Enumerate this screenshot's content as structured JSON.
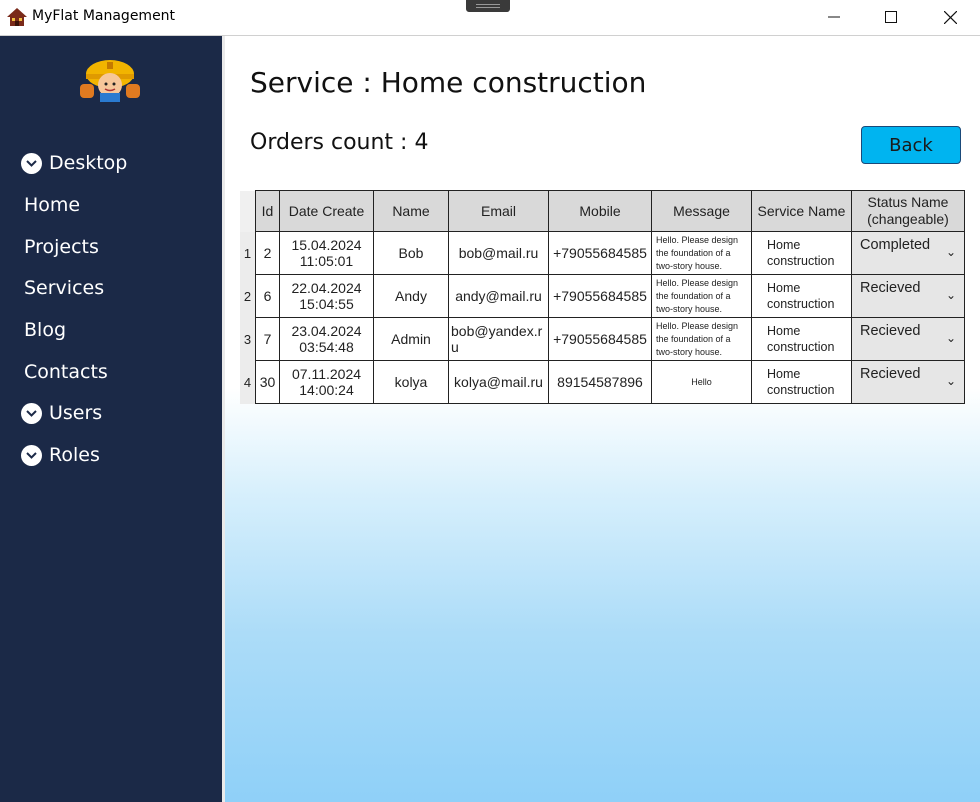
{
  "window": {
    "title": "MyFlat Management"
  },
  "sidebar": {
    "items": [
      {
        "label": "Desktop",
        "expandable": true
      },
      {
        "label": "Home",
        "expandable": false
      },
      {
        "label": "Projects",
        "expandable": false
      },
      {
        "label": "Services",
        "expandable": false
      },
      {
        "label": "Blog",
        "expandable": false
      },
      {
        "label": "Contacts",
        "expandable": false
      },
      {
        "label": "Users",
        "expandable": true
      },
      {
        "label": "Roles",
        "expandable": true
      }
    ]
  },
  "main": {
    "title": "Service : Home construction",
    "orders_count": "Orders count : 4",
    "back_label": "Back"
  },
  "table": {
    "columns": [
      "Id",
      "Date Create",
      "Name",
      "Email",
      "Mobile",
      "Message",
      "Service Name",
      "Status Name (changeable)"
    ],
    "rows": [
      {
        "n": "1",
        "id": "2",
        "date": "15.04.2024",
        "time": "11:05:01",
        "name": "Bob",
        "email": "bob@mail.ru",
        "mobile": "+79055684585",
        "message": "Hello. Please design the foundation of a two-story house.",
        "service_1": "Home",
        "service_2": "construction",
        "status": "Completed"
      },
      {
        "n": "2",
        "id": "6",
        "date": "22.04.2024",
        "time": "15:04:55",
        "name": "Andy",
        "email": "andy@mail.ru",
        "mobile": "+79055684585",
        "message": "Hello. Please design the foundation of a two-story house.",
        "service_1": "Home",
        "service_2": "construction",
        "status": "Recieved"
      },
      {
        "n": "3",
        "id": "7",
        "date": "23.04.2024",
        "time": "03:54:48",
        "name": "Admin",
        "email": "bob@yandex.ru",
        "mobile": "+79055684585",
        "message": "Hello. Please design the foundation of a two-story house.",
        "service_1": "Home",
        "service_2": "construction",
        "status": "Recieved"
      },
      {
        "n": "4",
        "id": "30",
        "date": "07.11.2024",
        "time": "14:00:24",
        "name": "kolya",
        "email": "kolya@mail.ru",
        "mobile": "89154587896",
        "message": "Hello",
        "service_1": "Home",
        "service_2": "construction",
        "status": "Recieved"
      }
    ]
  },
  "icons": {
    "app": "house-icon",
    "minimize": "minimize-icon",
    "maximize": "maximize-icon",
    "close": "close-icon",
    "expand": "chevron-down-circle-icon",
    "dropdown": "chevron-down-icon"
  },
  "colors": {
    "sidebar": "#1b2947",
    "back_button": "#00b4f0",
    "gradient_bottom": "#8fd0f8"
  }
}
